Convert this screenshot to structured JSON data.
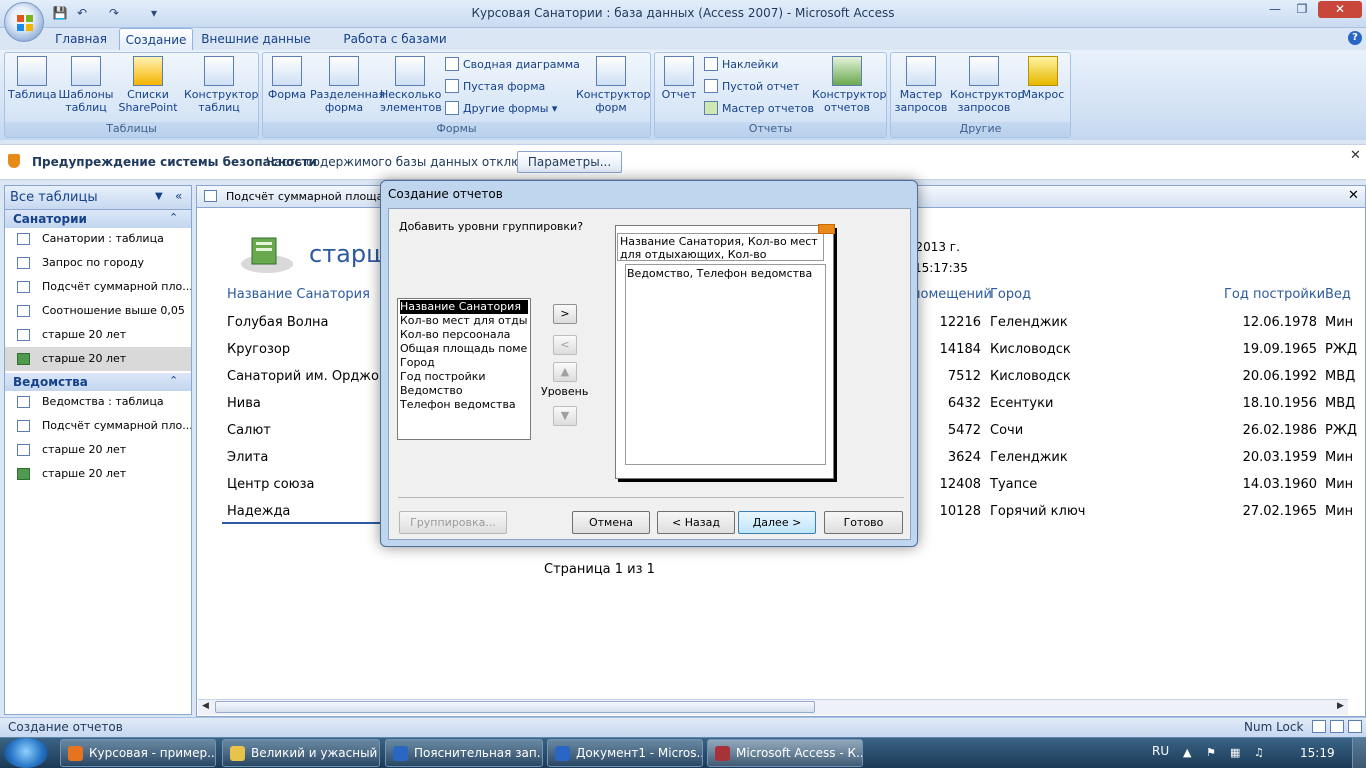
{
  "window": {
    "title": "Курсовая Санатории : база данных (Access 2007) - Microsoft Access"
  },
  "tabs": [
    "Главная",
    "Создание",
    "Внешние данные",
    "Работа с базами данных"
  ],
  "active_tab": "Создание",
  "ribbon": {
    "groups": [
      {
        "label": "Таблицы",
        "buttons": [
          "Таблица",
          "Шаблоны таблиц",
          "Списки SharePoint",
          "Конструктор таблиц"
        ]
      },
      {
        "label": "Формы",
        "buttons": [
          "Форма",
          "Разделенная форма",
          "Несколько элементов",
          "Конструктор форм"
        ],
        "small": [
          "Сводная диаграмма",
          "Пустая форма",
          "Другие формы"
        ]
      },
      {
        "label": "Отчеты",
        "buttons": [
          "Отчет",
          "Конструктор отчетов"
        ],
        "small": [
          "Наклейки",
          "Пустой отчет",
          "Мастер отчетов"
        ]
      },
      {
        "label": "Другие",
        "buttons": [
          "Мастер запросов",
          "Конструктор запросов",
          "Макрос"
        ]
      }
    ]
  },
  "security": {
    "title": "Предупреждение системы безопасности",
    "message": "Часть содержимого базы данных отключено",
    "button": "Параметры..."
  },
  "nav": {
    "header": "Все таблицы",
    "sections": [
      {
        "title": "Санатории",
        "items": [
          "Санатории : таблица",
          "Запрос по городу",
          "Подсчёт суммарной пло...",
          "Соотношение выше 0,05",
          "старше 20 лет",
          "старше 20 лет"
        ]
      },
      {
        "title": "Ведомства",
        "items": [
          "Ведомства : таблица",
          "Подсчёт суммарной пло...",
          "старше 20 лет",
          "старше 20 лет"
        ]
      }
    ]
  },
  "document": {
    "tab": "Подсчёт суммарной площади",
    "report_title": "старше",
    "date_frag": "р 2013 г.",
    "time_frag": "15:17:35",
    "columns": [
      "Название Санатория",
      "помещений",
      "Город",
      "Год постройки",
      "Вед"
    ],
    "rows": [
      [
        "Голубая Волна",
        "12216",
        "Геленджик",
        "12.06.1978",
        "Мин"
      ],
      [
        "Кругозор",
        "14184",
        "Кисловодск",
        "19.09.1965",
        "РЖД"
      ],
      [
        "Санаторий им. Орджони",
        "7512",
        "Кисловодск",
        "20.06.1992",
        "МВД"
      ],
      [
        "Нива",
        "6432",
        "Есентуки",
        "18.10.1956",
        "МВД"
      ],
      [
        "Салют",
        "5472",
        "Сочи",
        "26.02.1986",
        "РЖД"
      ],
      [
        "Элита",
        "3624",
        "Геленджик",
        "20.03.1959",
        "Мин"
      ],
      [
        "Центр союза",
        "12408",
        "Туапсе",
        "14.03.1960",
        "Мин"
      ],
      [
        "Надежда",
        "10128",
        "Горячий ключ",
        "27.02.1965",
        "Мин"
      ]
    ],
    "page": "Страница 1 из 1"
  },
  "dialog": {
    "title": "Создание отчетов",
    "question": "Добавить уровни группировки?",
    "fields": [
      "Название Санатория",
      "Кол-во мест для отдыхающих",
      "Кол-во персоонала",
      "Общая площадь помещений",
      "Город",
      "Год постройки",
      "Ведомство",
      "Телефон ведомства"
    ],
    "selected_field": "Название Санатория",
    "level_label": "Уровень",
    "preview_top": "Название Санатория, Кол-во мест для отдыхающих, Кол-во персоонала,",
    "preview_group": "Ведомство, Телефон ведомства",
    "buttons": {
      "grouping": "Группировка...",
      "cancel": "Отмена",
      "back": "< Назад",
      "next": "Далее >",
      "finish": "Готово"
    }
  },
  "status": {
    "left": "Создание отчетов",
    "right": "Num Lock"
  },
  "taskbar": {
    "items": [
      "Курсовая - пример....",
      "Великий и ужасный Я",
      "Пояснительная зап...",
      "Документ1 - Micros...",
      "Microsoft Access - К..."
    ],
    "lang": "RU",
    "clock": "15:19"
  },
  "colors": {
    "accent": "#2c5aa0",
    "ribbon": "#d2e1f4",
    "security_icon": "#e88a1a"
  }
}
